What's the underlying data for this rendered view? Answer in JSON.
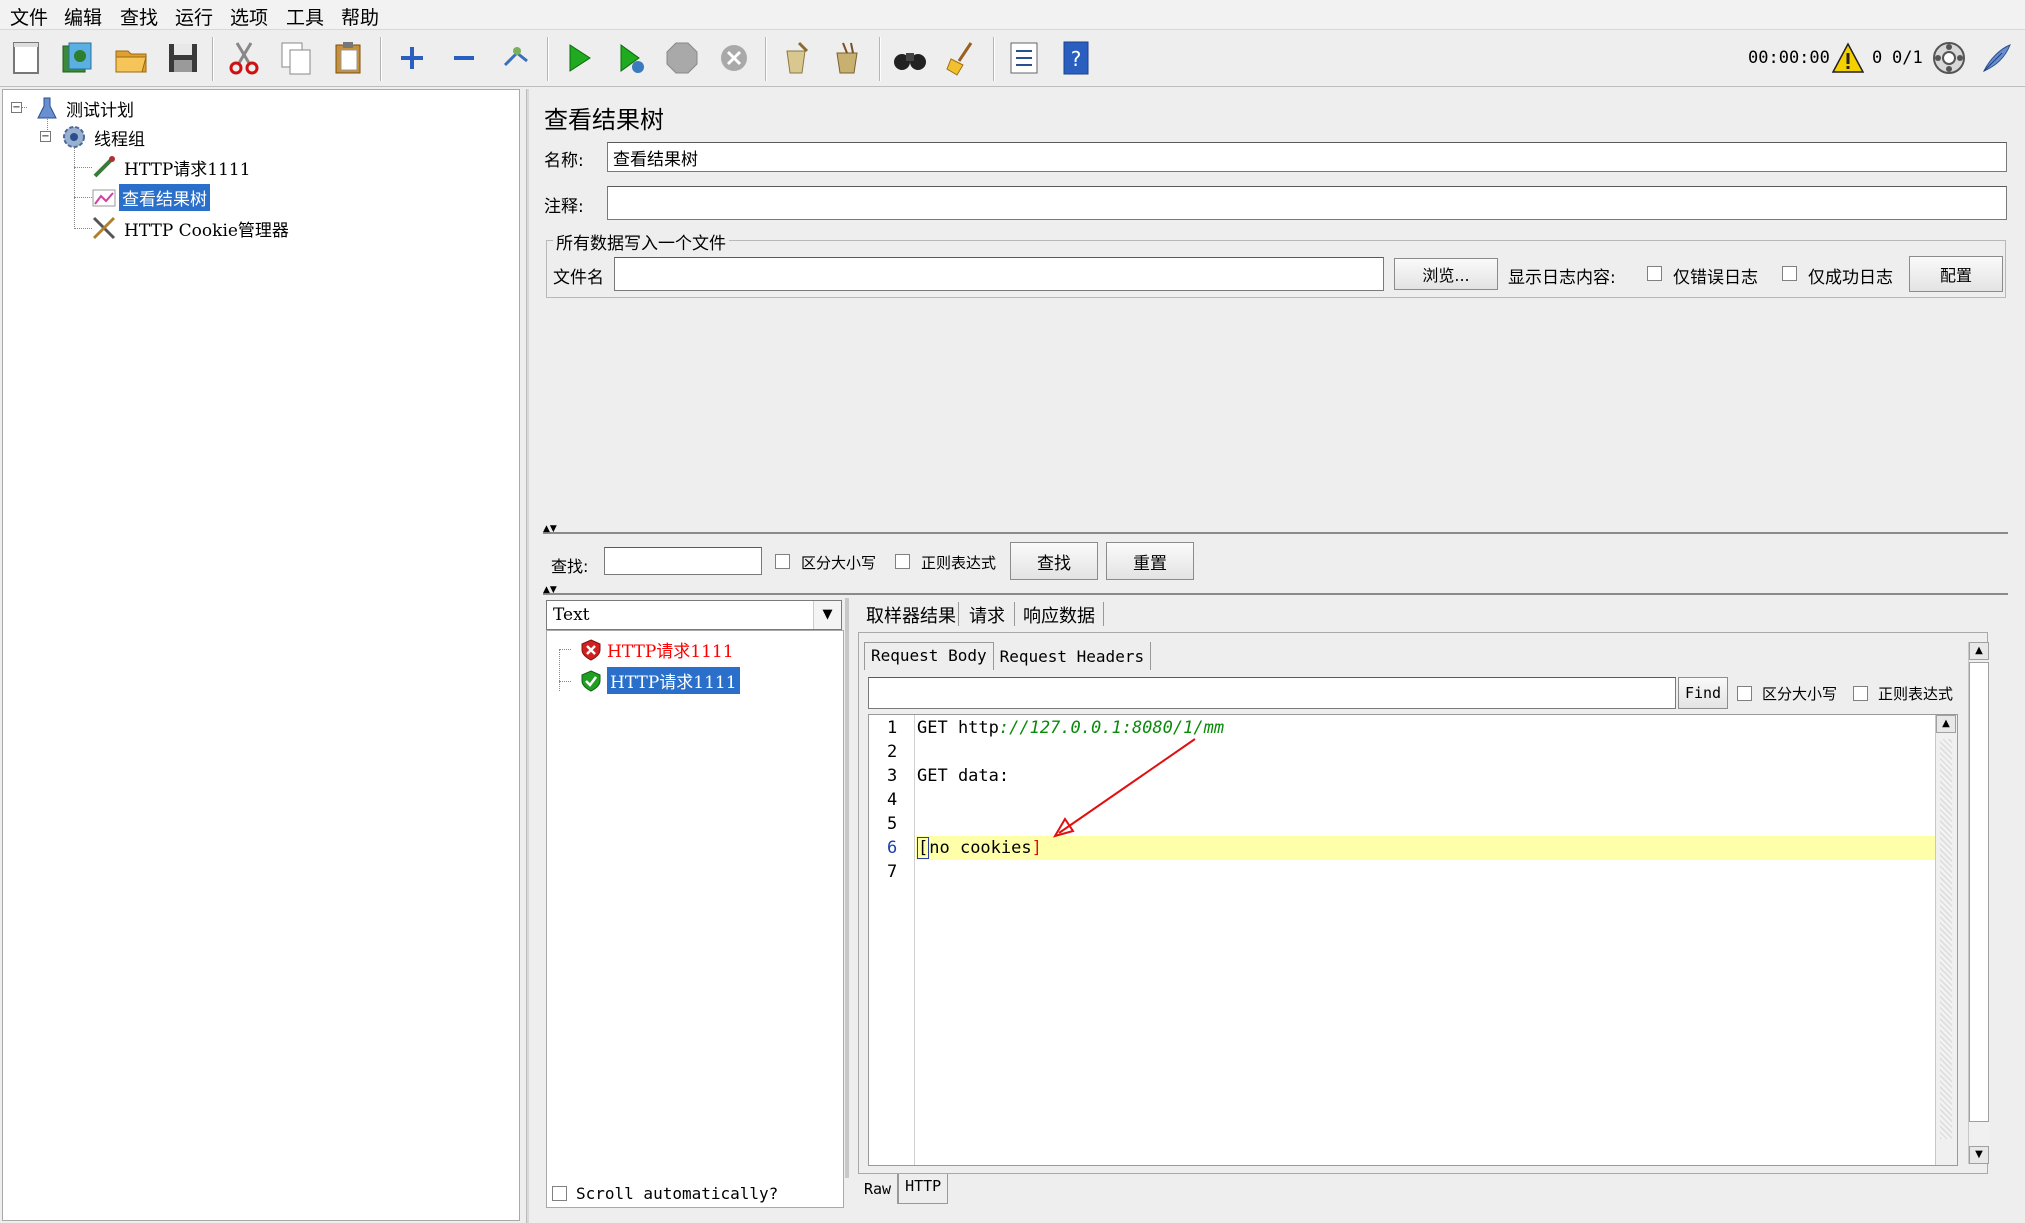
{
  "menu": [
    "文件",
    "编辑",
    "查找",
    "运行",
    "选项",
    "工具",
    "帮助"
  ],
  "toolbar": {
    "icons": [
      "new-icon",
      "templates-icon",
      "open-icon",
      "save-icon",
      "cut-icon",
      "copy-icon",
      "paste-icon",
      "expand-icon",
      "collapse-icon",
      "toggle-icon",
      "start-icon",
      "start-no-pause-icon",
      "stop-icon",
      "shutdown-icon",
      "clear-icon",
      "clear-all-icon",
      "search-icon",
      "reset-search-icon",
      "function-helper-icon",
      "help-icon"
    ],
    "timer": "00:00:00",
    "warning_count": "0",
    "thread_ratio": "0/1"
  },
  "tree": {
    "items": [
      {
        "label": "测试计划",
        "icon": "test-plan-icon"
      },
      {
        "label": "线程组",
        "icon": "thread-group-icon"
      },
      {
        "label": "HTTP请求1111",
        "icon": "http-sampler-icon"
      },
      {
        "label": "查看结果树",
        "icon": "results-tree-icon"
      },
      {
        "label": "HTTP Cookie管理器",
        "icon": "cookie-manager-icon"
      }
    ]
  },
  "panel": {
    "title": "查看结果树",
    "name_label": "名称:",
    "name_value": "查看结果树",
    "comment_label": "注释:",
    "comment_value": "",
    "file_group_title": "所有数据写入一个文件",
    "file_label": "文件名",
    "file_value": "",
    "browse_label": "浏览...",
    "log_display_label": "显示日志内容:",
    "errors_only_label": "仅错误日志",
    "success_only_label": "仅成功日志",
    "configure_label": "配置"
  },
  "search": {
    "label": "查找:",
    "value": "",
    "case_label": "区分大小写",
    "regex_label": "正则表达式",
    "find_label": "查找",
    "reset_label": "重置"
  },
  "results": {
    "renderer": "Text",
    "samples": [
      {
        "label": "HTTP请求1111",
        "status": "error"
      },
      {
        "label": "HTTP请求1111",
        "status": "success"
      }
    ],
    "scroll_auto_label": "Scroll automatically?"
  },
  "detail": {
    "tabs": [
      "取样器结果",
      "请求",
      "响应数据"
    ],
    "sub_tabs": [
      "Request Body",
      "Request Headers"
    ],
    "find_value": "",
    "find_label": "Find",
    "case_label": "区分大小写",
    "regex_label": "正则表达式",
    "lines": [
      {
        "num": "1",
        "text": "GET http://127.0.0.1:8080/1/mm"
      },
      {
        "num": "2",
        "text": ""
      },
      {
        "num": "3",
        "text": "GET data:"
      },
      {
        "num": "4",
        "text": ""
      },
      {
        "num": "5",
        "text": ""
      },
      {
        "num": "6",
        "text": "[no cookies]"
      },
      {
        "num": "7",
        "text": ""
      }
    ],
    "bottom_tabs": [
      "Raw",
      "HTTP"
    ]
  },
  "colors": {
    "selection": "#2a6fc9",
    "error_text": "#ff0000",
    "url_green": "#0a8a0a",
    "highlight_line": "#ffffaa",
    "annotation_arrow": "#e01010"
  }
}
